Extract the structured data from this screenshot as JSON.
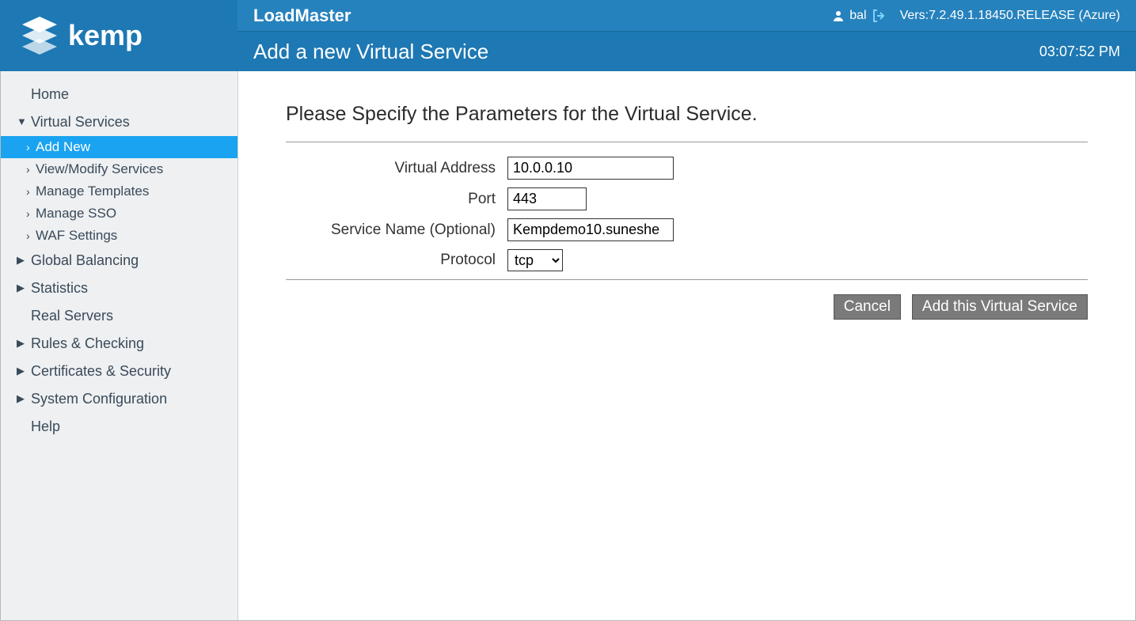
{
  "header": {
    "product": "LoadMaster",
    "page_title": "Add a new Virtual Service",
    "username": "bal",
    "version": "Vers:7.2.49.1.18450.RELEASE (Azure)",
    "clock": "03:07:52 PM"
  },
  "sidebar": {
    "items": [
      {
        "label": "Home",
        "type": "item"
      },
      {
        "label": "Virtual Services",
        "type": "expanded",
        "children": [
          {
            "label": "Add New",
            "active": true
          },
          {
            "label": "View/Modify Services"
          },
          {
            "label": "Manage Templates"
          },
          {
            "label": "Manage SSO"
          },
          {
            "label": "WAF Settings"
          }
        ]
      },
      {
        "label": "Global Balancing",
        "type": "collapsed"
      },
      {
        "label": "Statistics",
        "type": "collapsed"
      },
      {
        "label": "Real Servers",
        "type": "item"
      },
      {
        "label": "Rules & Checking",
        "type": "collapsed"
      },
      {
        "label": "Certificates & Security",
        "type": "collapsed"
      },
      {
        "label": "System Configuration",
        "type": "collapsed"
      },
      {
        "label": "Help",
        "type": "item"
      }
    ]
  },
  "form": {
    "heading": "Please Specify the Parameters for the Virtual Service.",
    "labels": {
      "virtual_address": "Virtual Address",
      "port": "Port",
      "service_name": "Service Name (Optional)",
      "protocol": "Protocol"
    },
    "values": {
      "virtual_address": "10.0.0.10",
      "port": "443",
      "service_name": "Kempdemo10.suneshe",
      "protocol": "tcp"
    },
    "buttons": {
      "cancel": "Cancel",
      "add": "Add this Virtual Service"
    }
  }
}
